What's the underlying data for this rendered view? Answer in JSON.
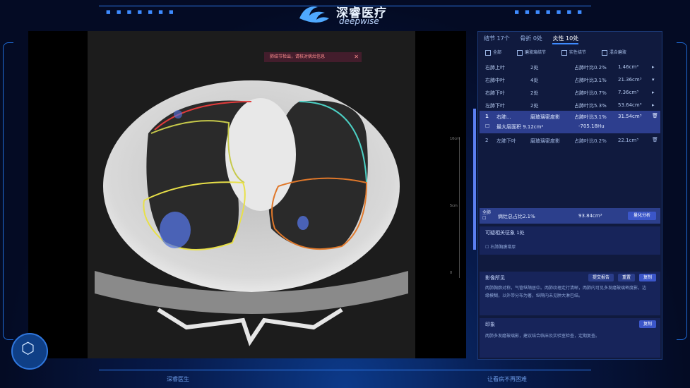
{
  "brand": {
    "cn": "深睿医疗",
    "en": "deepwise"
  },
  "warning": {
    "text": "肺结节检出，请核对病灶信息",
    "close": "✕"
  },
  "scale_labels": [
    "10cm",
    "5cm",
    "0"
  ],
  "tabs": [
    {
      "label": "结节 17个"
    },
    {
      "label": "骨折 0处"
    },
    {
      "label": "炎性 10处"
    }
  ],
  "filters": [
    "全部",
    "磨玻璃结节",
    "实性结节",
    "混合磨玻"
  ],
  "rows": [
    {
      "name": "右肺上叶",
      "count": "2处",
      "ratio": "占肺叶比0.2%",
      "vol": "1.46cm³"
    },
    {
      "name": "右肺中叶",
      "count": "4处",
      "ratio": "占肺叶比3.1%",
      "vol": "21.36cm³"
    },
    {
      "name": "右肺下叶",
      "count": "2处",
      "ratio": "占肺叶比0.7%",
      "vol": "7.36cm³"
    },
    {
      "name": "左肺下叶",
      "count": "2处",
      "ratio": "占肺叶比5.3%",
      "vol": "53.64cm³"
    }
  ],
  "lesion1": {
    "index": "1",
    "type": "右肺...",
    "kind": "磨玻璃密度影",
    "ratio": "占肺叶比3.1%",
    "vol": "31.54cm³",
    "extra": "最大层面积 9.12cm²",
    "hu": "-705.18Hu"
  },
  "lesion2": {
    "index": "2",
    "type": "左肺下叶",
    "kind": "磨玻璃密度影",
    "ratio": "占肺叶比0.2%",
    "vol": "22.1cm³"
  },
  "summary": {
    "label": "全肺",
    "ratio": "病灶总占比2.1%",
    "vol": "93.84cm³",
    "btn": "量化分析"
  },
  "related": {
    "title": "可疑相关征象 1处",
    "item": "右肺胸膜增厚"
  },
  "findings": {
    "title": "影像所见",
    "btn1": "提交报告",
    "btn2": "重置",
    "btn3": "复制",
    "text": "两肺胸廓对称，气管纵隔居中。两肺纹理走行清晰，两肺内可见多发磨玻璃密度影，边缘模糊，以外带分布为著，纵隔内未见肿大淋巴结。"
  },
  "impression": {
    "title": "印象",
    "btn": "复制",
    "text": "两肺多发磨玻璃影，建议结合临床及实验室检查，定期复查。"
  },
  "footer": {
    "left": "深睿医生",
    "right": "让看病不再困难"
  },
  "colors": {
    "accent": "#3e8bff",
    "panel": "#101a3e",
    "highlight": "#2d3e8e"
  }
}
